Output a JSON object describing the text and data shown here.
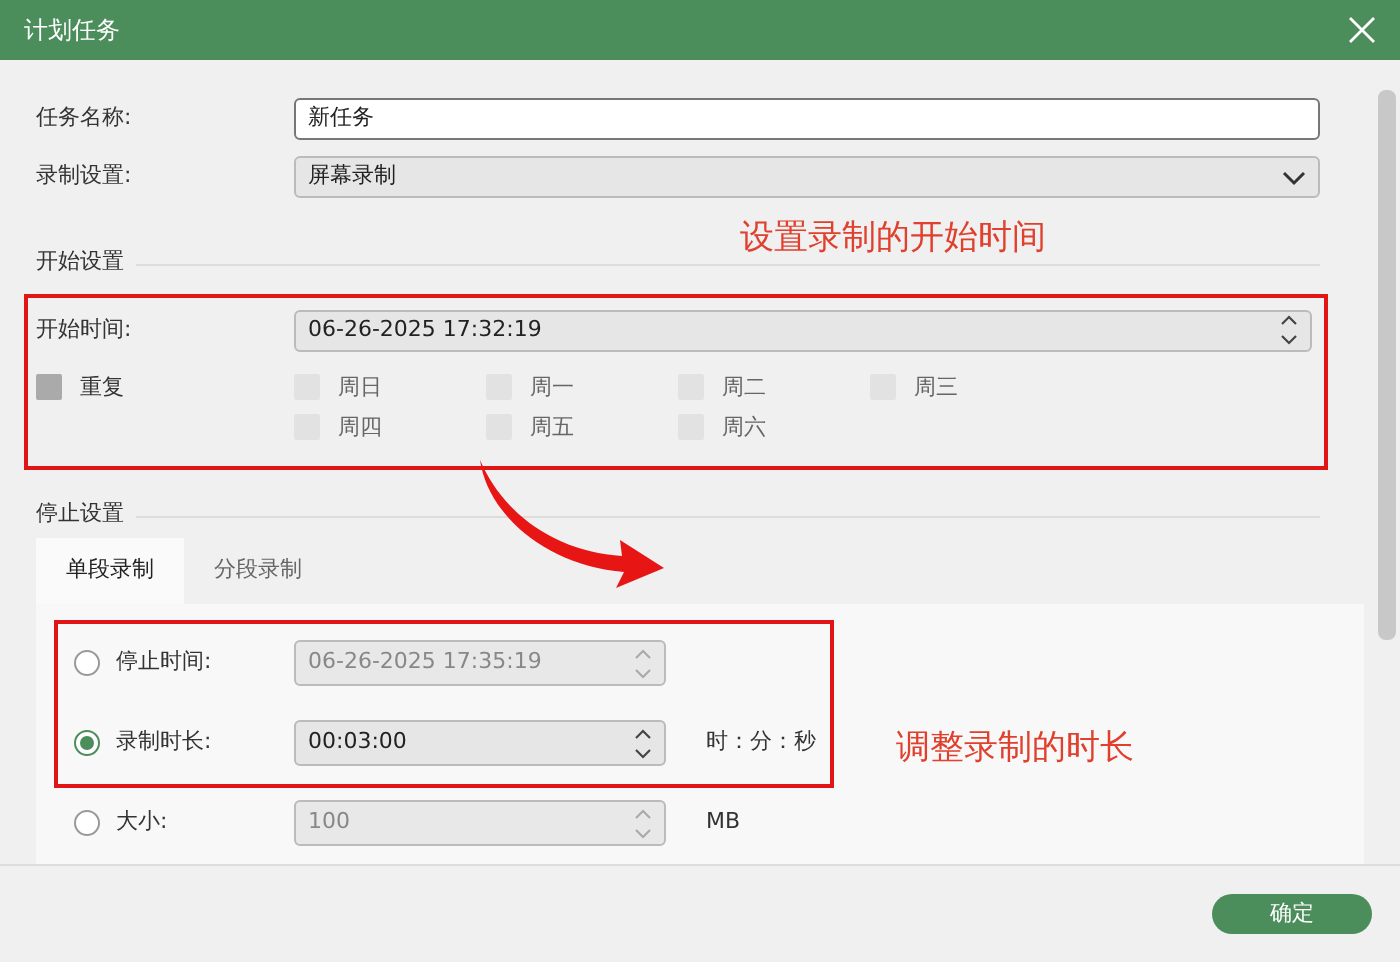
{
  "window": {
    "title": "计划任务"
  },
  "fields": [
    {
      "label": "任务名称:",
      "value": "新任务",
      "kind": "text"
    },
    {
      "label": "录制设置:",
      "value": "屏幕录制",
      "kind": "select"
    }
  ],
  "start_section": {
    "heading": "开始设置",
    "annotation": "设置录制的开始时间",
    "start_time": {
      "label": "开始时间:",
      "value": "06-26-2025 17:32:19"
    },
    "repeat": {
      "label": "重复",
      "checked": false
    },
    "weekdays": [
      {
        "label": "周日",
        "checked": false
      },
      {
        "label": "周一",
        "checked": false
      },
      {
        "label": "周二",
        "checked": false
      },
      {
        "label": "周三",
        "checked": false
      },
      {
        "label": "周四",
        "checked": false
      },
      {
        "label": "周五",
        "checked": false
      },
      {
        "label": "周六",
        "checked": false
      }
    ]
  },
  "stop_section": {
    "heading": "停止设置",
    "annotation": "调整录制的时长",
    "tabs": [
      {
        "label": "单段录制",
        "selected": true
      },
      {
        "label": "分段录制",
        "selected": false
      }
    ],
    "options": [
      {
        "label": "停止时间:",
        "value": "06-26-2025 17:35:19",
        "selected": false
      },
      {
        "label": "录制时长:",
        "value": "00:03:00",
        "selected": true,
        "unit": "时：分：秒"
      },
      {
        "label": "大小:",
        "value": "100",
        "selected": false,
        "unit": "MB"
      }
    ]
  },
  "footer": {
    "button": "确定"
  }
}
